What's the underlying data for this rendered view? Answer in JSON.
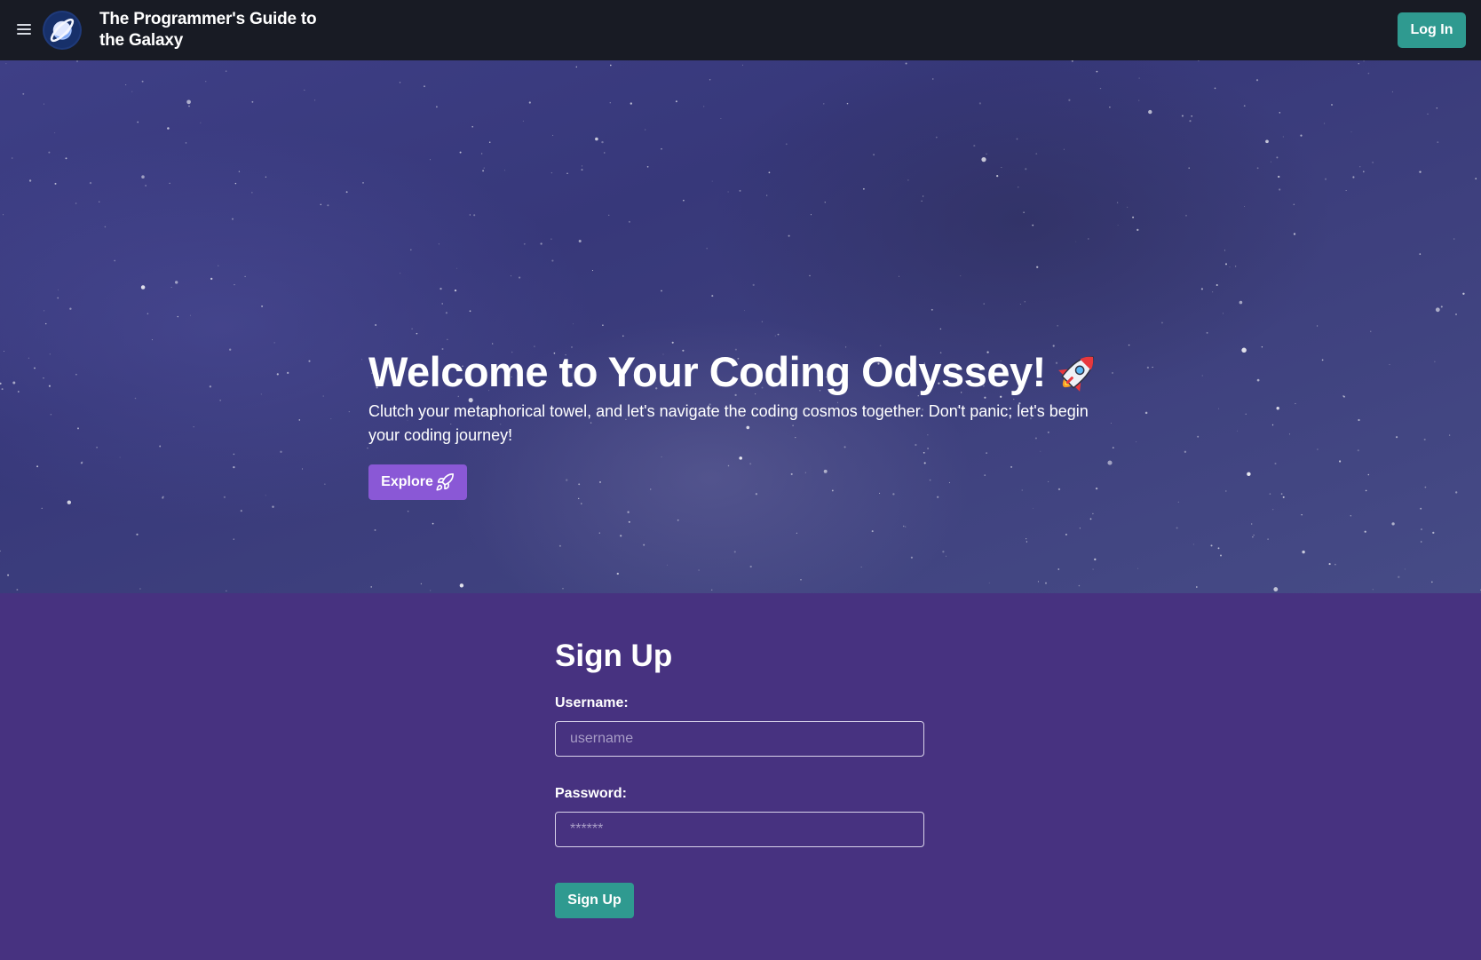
{
  "header": {
    "brand_title": "The Programmer's Guide to the Galaxy",
    "login_label": "Log In",
    "icons": {
      "menu": "hamburger-menu-icon",
      "logo": "planet-logo-icon"
    }
  },
  "hero": {
    "title": "Welcome to Your Coding Odyssey!",
    "title_icon": "rocket-emoji-icon",
    "subtitle": "Clutch your metaphorical towel, and let's navigate the coding cosmos together. Don't panic; let's begin your coding journey!",
    "explore_label": "Explore",
    "explore_icon": "rocket-icon"
  },
  "signup": {
    "title": "Sign Up",
    "username_label": "Username:",
    "username_placeholder": "username",
    "password_label": "Password:",
    "password_placeholder": "******",
    "submit_label": "Sign Up"
  },
  "colors": {
    "navbar_bg": "#181b24",
    "accent_teal": "#2f9a90",
    "explore_purple": "#8a58d6",
    "signup_bg": "#473280"
  }
}
